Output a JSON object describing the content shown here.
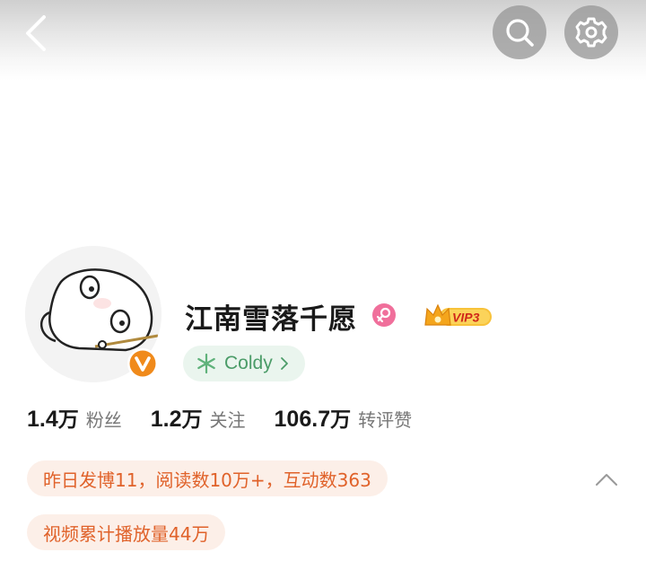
{
  "nav": {
    "back_icon": "chevron-left-icon",
    "search_icon": "search-icon",
    "settings_icon": "gear-icon"
  },
  "profile": {
    "name": "江南雪落千愿",
    "gender_icon": "female-icon",
    "vip_label": "VIP3",
    "verified_icon": "verified-v-icon",
    "fan_chip_label": "Coldy",
    "fan_chip_icon": "snowflake-icon"
  },
  "stats": [
    {
      "num": "1.4",
      "unit": "万",
      "label": "粉丝"
    },
    {
      "num": "1.2",
      "unit": "万",
      "label": "关注"
    },
    {
      "num": "106.7",
      "unit": "万",
      "label": "转评赞"
    }
  ],
  "insights": {
    "line1": "昨日发博11，阅读数10万+，互动数363",
    "line2": "视频累计播放量44万"
  },
  "colors": {
    "accent_orange": "#e0622a",
    "pill_bg": "#fcefe8",
    "chip_green": "#4b9c68",
    "chip_bg": "#eaf5ee",
    "gender_pink": "#f06f9b",
    "vip_gold": "#f2b322"
  }
}
